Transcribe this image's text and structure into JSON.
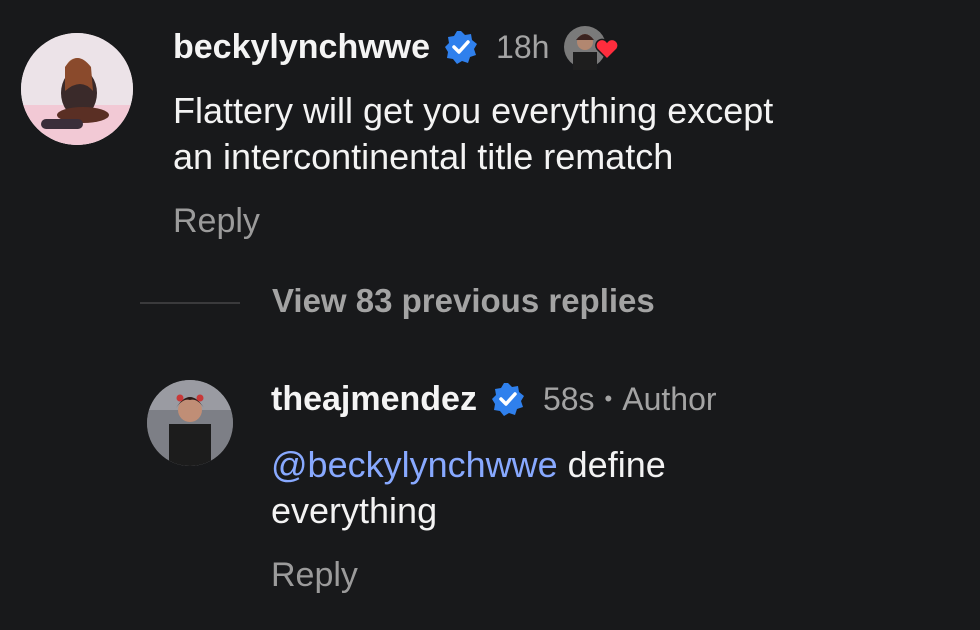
{
  "comment": {
    "username": "beckylynchwwe",
    "time": "18h",
    "text_line1": "Flattery will get you everything except",
    "text_line2": "an intercontinental title rematch",
    "reply_label": "Reply"
  },
  "thread": {
    "view_previous_label": "View 83 previous replies"
  },
  "reply": {
    "username": "theajmendez",
    "time": "58s",
    "separator": "•",
    "author_badge": "Author",
    "mention": "@beckylynchwwe",
    "text_rest": " define",
    "text_line2": "everything",
    "reply_label": "Reply"
  },
  "colors": {
    "background": "#18191b",
    "verified_blue": "#2f80ed",
    "heart_red": "#ff2d3d",
    "mention_blue": "#88a9ff"
  },
  "icons": {
    "verified": "verified-badge-icon",
    "heart": "heart-icon"
  }
}
